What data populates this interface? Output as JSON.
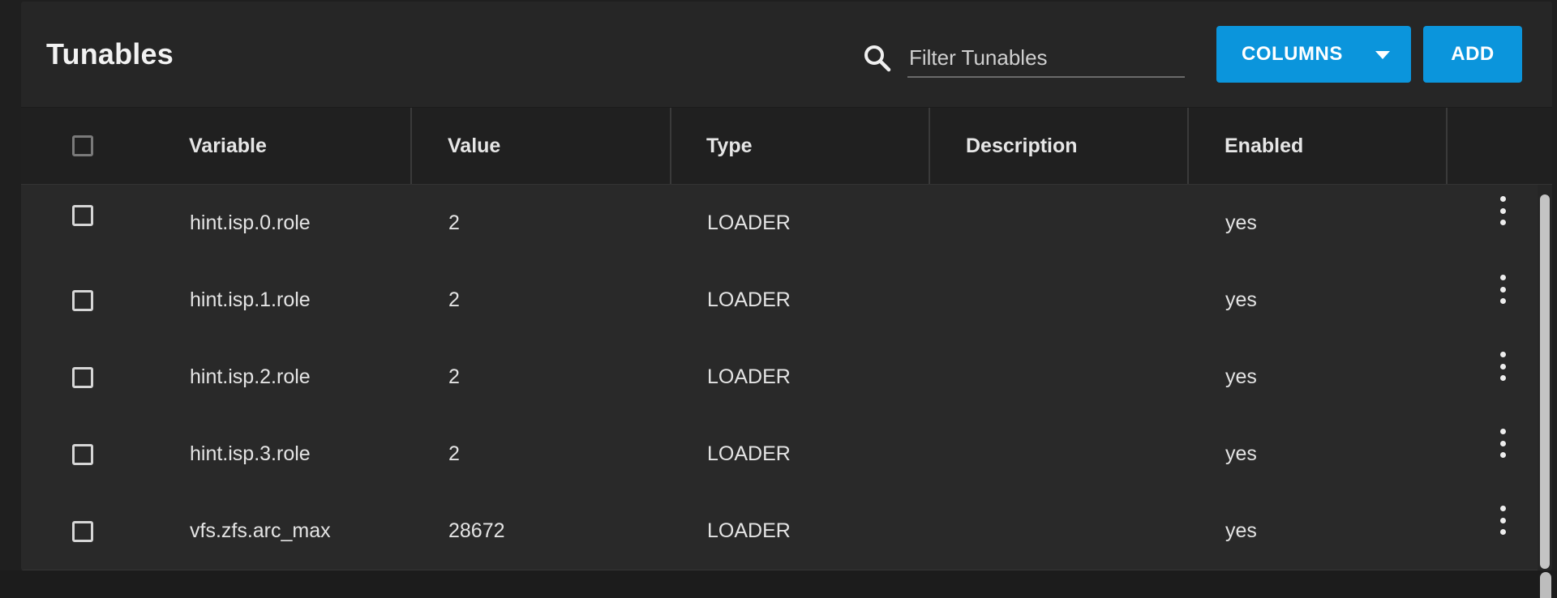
{
  "header": {
    "title": "Tunables",
    "search_placeholder": "Filter Tunables",
    "search_value": "",
    "columns_label": "COLUMNS",
    "add_label": "ADD"
  },
  "table": {
    "columns": [
      "Variable",
      "Value",
      "Type",
      "Description",
      "Enabled"
    ],
    "rows": [
      {
        "variable": "hint.isp.0.role",
        "value": "2",
        "type": "LOADER",
        "description": "",
        "enabled": "yes"
      },
      {
        "variable": "hint.isp.1.role",
        "value": "2",
        "type": "LOADER",
        "description": "",
        "enabled": "yes"
      },
      {
        "variable": "hint.isp.2.role",
        "value": "2",
        "type": "LOADER",
        "description": "",
        "enabled": "yes"
      },
      {
        "variable": "hint.isp.3.role",
        "value": "2",
        "type": "LOADER",
        "description": "",
        "enabled": "yes"
      },
      {
        "variable": "vfs.zfs.arc_max",
        "value": "28672",
        "type": "LOADER",
        "description": "",
        "enabled": "yes"
      }
    ]
  },
  "icons": {
    "search": "search-icon",
    "columns_dropdown": "caret-down-icon",
    "row_menu": "more-vert-icon"
  },
  "colors": {
    "accent": "#0b95dc",
    "background": "#1f1f1f",
    "card": "#282828"
  }
}
